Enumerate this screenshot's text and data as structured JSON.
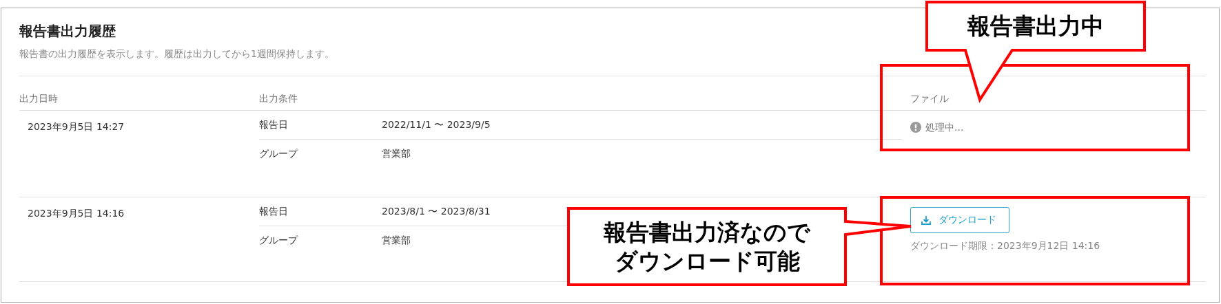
{
  "panel": {
    "title": "報告書出力履歴",
    "description": "報告書の出力履歴を表示します。履歴は出力してから1週間保持します。"
  },
  "table": {
    "columns": [
      "出力日時",
      "出力条件",
      "ファイル"
    ],
    "rows": [
      {
        "datetime": "2023年9月5日 14:27",
        "conditions": [
          {
            "label": "報告日",
            "value": "2022/11/1 〜 2023/9/5"
          },
          {
            "label": "グループ",
            "value": "営業部"
          }
        ],
        "file": {
          "kind": "processing",
          "status": "処理中...",
          "highlighted": true
        }
      },
      {
        "datetime": "2023年9月5日 14:16",
        "conditions": [
          {
            "label": "報告日",
            "value": "2023/8/1 〜 2023/8/31"
          },
          {
            "label": "グループ",
            "value": "営業部"
          }
        ],
        "file": {
          "kind": "download",
          "button": "ダウンロード",
          "expiry": "ダウンロード期限：2023年9月12日 14:16",
          "highlighted": true
        }
      }
    ]
  },
  "annotations": [
    {
      "kind": "callout",
      "lines": [
        "報告書出力中"
      ]
    },
    {
      "kind": "callout",
      "lines": [
        "報告書出力済なので",
        "ダウンロード可能"
      ]
    }
  ]
}
